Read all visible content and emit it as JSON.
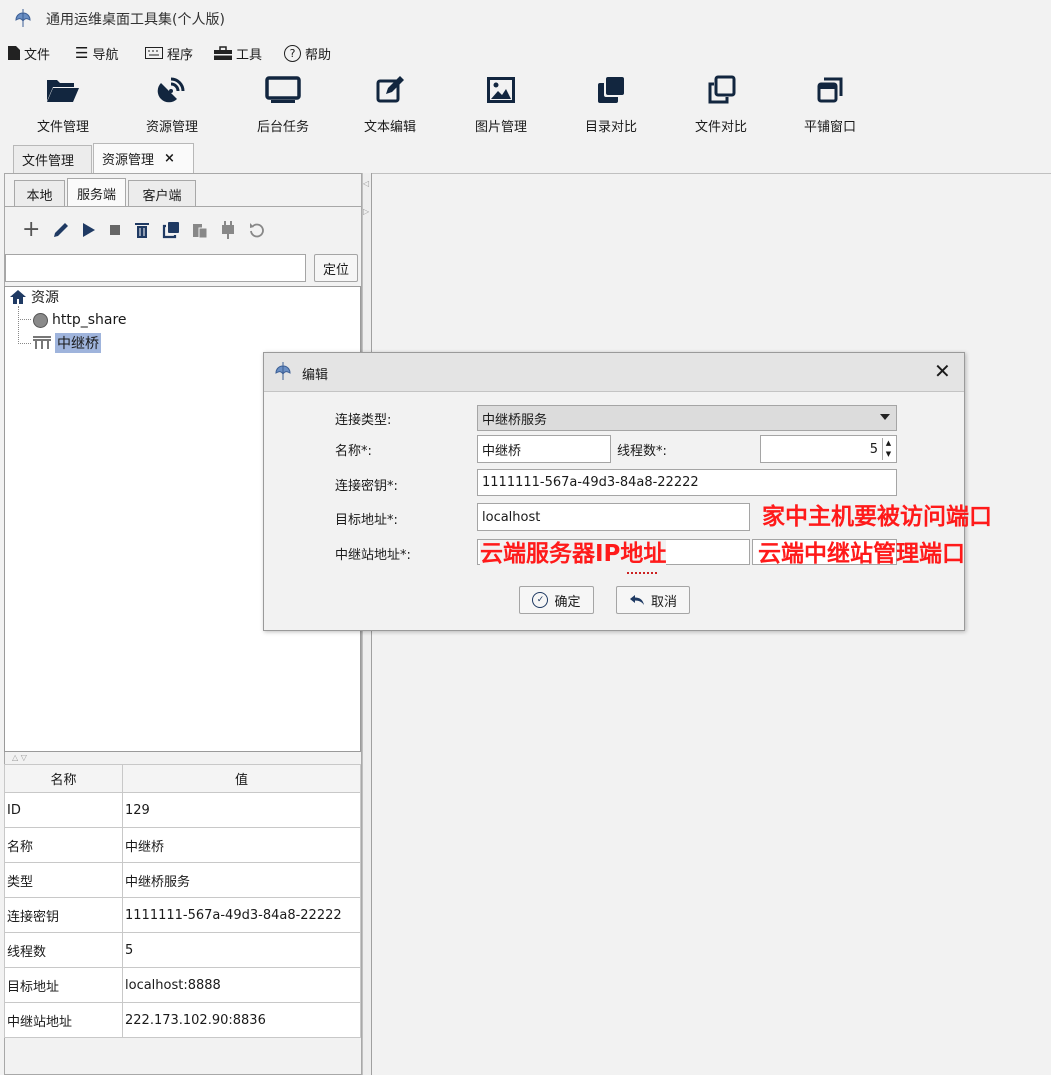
{
  "window": {
    "title": "通用运维桌面工具集(个人版)"
  },
  "menu": {
    "file": "文件",
    "nav": "导航",
    "program": "程序",
    "tools": "工具",
    "help": "帮助"
  },
  "toolbar": [
    {
      "label": "文件管理",
      "icon": "folder-open-icon"
    },
    {
      "label": "资源管理",
      "icon": "satellite-dish-icon"
    },
    {
      "label": "后台任务",
      "icon": "monitor-icon"
    },
    {
      "label": "文本编辑",
      "icon": "edit-icon"
    },
    {
      "label": "图片管理",
      "icon": "image-icon"
    },
    {
      "label": "目录对比",
      "icon": "clone-filled-icon"
    },
    {
      "label": "文件对比",
      "icon": "clone-outline-icon"
    },
    {
      "label": "平铺窗口",
      "icon": "window-restore-icon"
    }
  ],
  "doc_tabs": [
    {
      "label": "文件管理"
    },
    {
      "label": "资源管理",
      "close": "×"
    }
  ],
  "sub_tabs": [
    "本地",
    "服务端",
    "客户端"
  ],
  "search": {
    "value": "",
    "locate_button": "定位"
  },
  "tree": {
    "root": "资源",
    "children": [
      {
        "label": "http_share",
        "icon": "globe-icon"
      },
      {
        "label": "中继桥",
        "icon": "bridge-icon",
        "selected": true
      }
    ]
  },
  "properties": {
    "headers": {
      "name": "名称",
      "value": "值"
    },
    "rows": [
      {
        "name": "ID",
        "value": "129"
      },
      {
        "name": "名称",
        "value": "中继桥"
      },
      {
        "name": "类型",
        "value": "中继桥服务"
      },
      {
        "name": "连接密钥",
        "value": "1111111-567a-49d3-84a8-22222"
      },
      {
        "name": "线程数",
        "value": "5"
      },
      {
        "name": "目标地址",
        "value": "localhost:8888"
      },
      {
        "name": "中继站地址",
        "value": "222.173.102.90:8836"
      }
    ]
  },
  "dialog": {
    "title": "编辑",
    "close": "✕",
    "conn_type_label": "连接类型:",
    "conn_type_value": "中继桥服务",
    "name_label": "名称*:",
    "name_value": "中继桥",
    "threads_label": "线程数*:",
    "threads_value": "5",
    "key_label": "连接密钥*:",
    "key_value": "1111111-567a-49d3-84a8-22222",
    "target_label": "目标地址*:",
    "target_value": "localhost",
    "relay_label": "中继站地址*:",
    "ok": "确定",
    "cancel": "取消"
  },
  "annotations": {
    "target_port": "家中主机要被访问端口",
    "cloud_ip": "云端服务器IP地址",
    "relay_port": "云端中继站管理端口",
    "color": "#ff1a1a"
  }
}
